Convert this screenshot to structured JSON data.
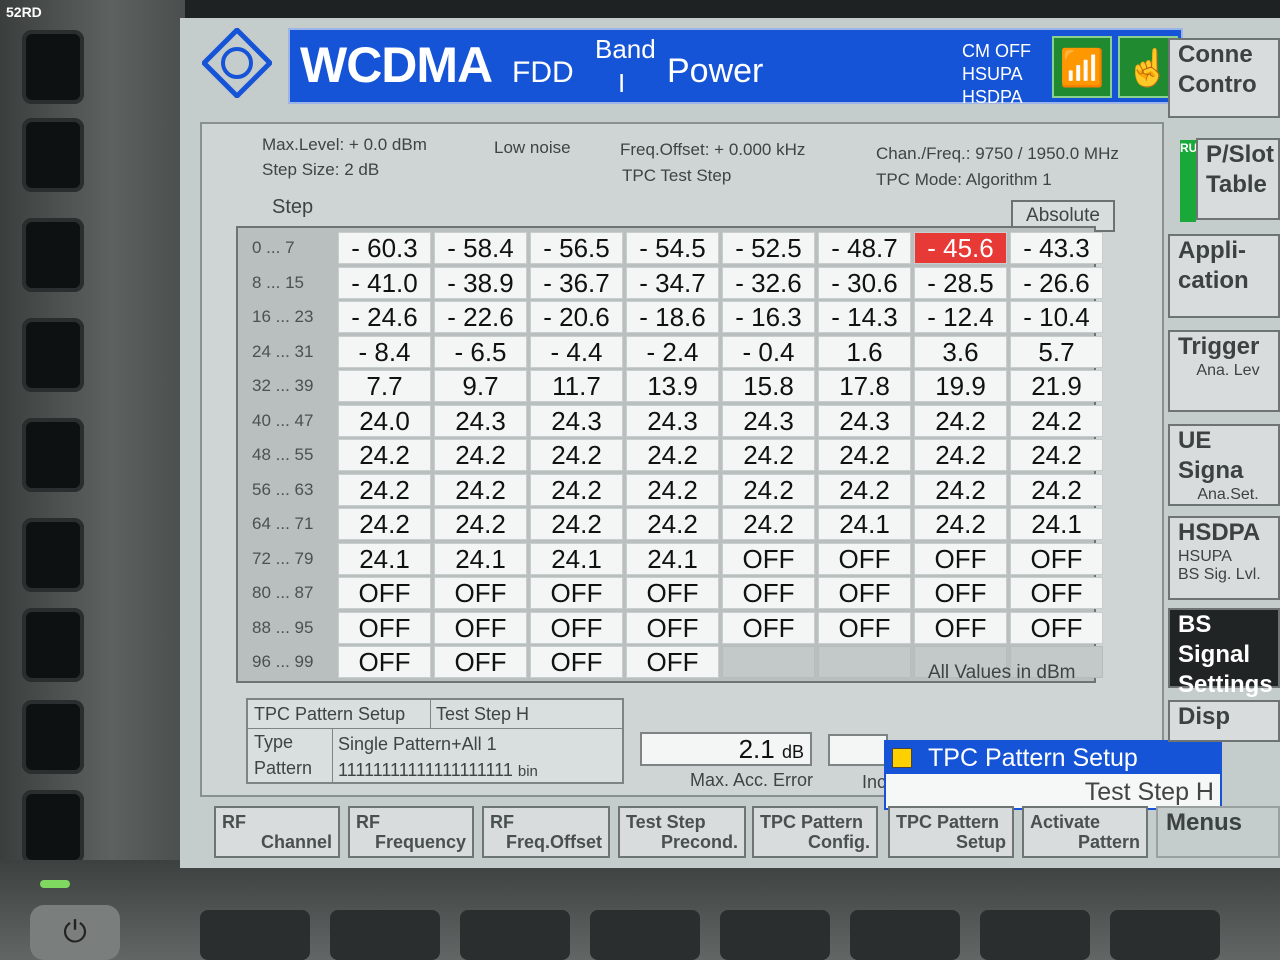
{
  "watermark": "52RD",
  "header": {
    "app": "WCDMA",
    "mode": "FDD",
    "band_label": "Band",
    "band_number": "I",
    "measurement": "Power",
    "status_lines": [
      "CM OFF",
      "HSUPA",
      "HSDPA"
    ]
  },
  "info": {
    "max_level": "Max.Level: + 0.0  dBm",
    "step_size": "Step Size: 2 dB",
    "noise": "Low noise",
    "freq_offset": "Freq.Offset: + 0.000  kHz",
    "tpc_test_step": "TPC Test Step",
    "chan_freq": "Chan./Freq.: 9750 / 1950.0  MHz",
    "tpc_mode": "TPC Mode: Algorithm 1"
  },
  "table": {
    "step_header": "Step",
    "mode_button": "Absolute",
    "unit_note": "All Values in dBm",
    "highlight_cell": [
      0,
      6
    ],
    "rows": [
      {
        "label": "0 ... 7",
        "values": [
          "- 60.3",
          "- 58.4",
          "- 56.5",
          "- 54.5",
          "- 52.5",
          "- 48.7",
          "- 45.6",
          "- 43.3"
        ]
      },
      {
        "label": "8 ... 15",
        "values": [
          "- 41.0",
          "- 38.9",
          "- 36.7",
          "- 34.7",
          "- 32.6",
          "- 30.6",
          "- 28.5",
          "- 26.6"
        ]
      },
      {
        "label": "16 ... 23",
        "values": [
          "- 24.6",
          "- 22.6",
          "- 20.6",
          "- 18.6",
          "- 16.3",
          "- 14.3",
          "- 12.4",
          "- 10.4"
        ]
      },
      {
        "label": "24 ... 31",
        "values": [
          "- 8.4",
          "- 6.5",
          "- 4.4",
          "- 2.4",
          "- 0.4",
          "1.6",
          "3.6",
          "5.7"
        ]
      },
      {
        "label": "32 ... 39",
        "values": [
          "7.7",
          "9.7",
          "11.7",
          "13.9",
          "15.8",
          "17.8",
          "19.9",
          "21.9"
        ]
      },
      {
        "label": "40 ... 47",
        "values": [
          "24.0",
          "24.3",
          "24.3",
          "24.3",
          "24.3",
          "24.3",
          "24.2",
          "24.2"
        ]
      },
      {
        "label": "48 ... 55",
        "values": [
          "24.2",
          "24.2",
          "24.2",
          "24.2",
          "24.2",
          "24.2",
          "24.2",
          "24.2"
        ]
      },
      {
        "label": "56 ... 63",
        "values": [
          "24.2",
          "24.2",
          "24.2",
          "24.2",
          "24.2",
          "24.2",
          "24.2",
          "24.2"
        ]
      },
      {
        "label": "64 ... 71",
        "values": [
          "24.2",
          "24.2",
          "24.2",
          "24.2",
          "24.2",
          "24.1",
          "24.2",
          "24.1"
        ]
      },
      {
        "label": "72 ... 79",
        "values": [
          "24.1",
          "24.1",
          "24.1",
          "24.1",
          "OFF",
          "OFF",
          "OFF",
          "OFF"
        ]
      },
      {
        "label": "80 ... 87",
        "values": [
          "OFF",
          "OFF",
          "OFF",
          "OFF",
          "OFF",
          "OFF",
          "OFF",
          "OFF"
        ]
      },
      {
        "label": "88 ... 95",
        "values": [
          "OFF",
          "OFF",
          "OFF",
          "OFF",
          "OFF",
          "OFF",
          "OFF",
          "OFF"
        ]
      },
      {
        "label": "96 ... 99",
        "values": [
          "OFF",
          "OFF",
          "OFF",
          "OFF",
          "",
          "",
          "",
          ""
        ]
      }
    ]
  },
  "tpc_setup": {
    "title": "TPC Pattern Setup",
    "selected": "Test Step H",
    "type_label": "Type",
    "type_value": "Single Pattern+All 1",
    "pattern_label": "Pattern",
    "pattern_value": "11111111111111111111",
    "pattern_unit": "bin"
  },
  "accuracy": {
    "value": "2.1",
    "unit": "dB",
    "label": "Max. Acc. Error",
    "inc_label": "Inc"
  },
  "popup": {
    "title": "TPC Pattern Setup",
    "value": "Test Step H"
  },
  "softkeys": [
    {
      "l1": "RF",
      "l2": "Channel"
    },
    {
      "l1": "RF",
      "l2": "Frequency"
    },
    {
      "l1": "RF",
      "l2": "Freq.Offset"
    },
    {
      "l1": "Test Step",
      "l2": "Precond."
    },
    {
      "l1": "TPC Pattern",
      "l2": "Config."
    },
    {
      "l1": "TPC Pattern",
      "l2": "Setup"
    },
    {
      "l1": "Activate",
      "l2": "Pattern"
    }
  ],
  "sidekeys": {
    "connect": "Conne",
    "control": "Contro",
    "run": "RUN",
    "pslot1": "P/Slot",
    "pslot2": "Table",
    "appli1": "Appli-",
    "appli2": "cation",
    "trigger": "Trigger",
    "trigger_sub": "Ana. Lev",
    "ue_signal": "UE Signa",
    "ue_sub": "Ana.Set.",
    "hsdpa": "HSDPA",
    "hsdpa_sub1": "HSUPA",
    "hsdpa_sub2": "BS Sig. Lvl.",
    "bs1": "BS Signal",
    "bs2": "Settings",
    "display": "Disp",
    "menus": "Menus"
  }
}
